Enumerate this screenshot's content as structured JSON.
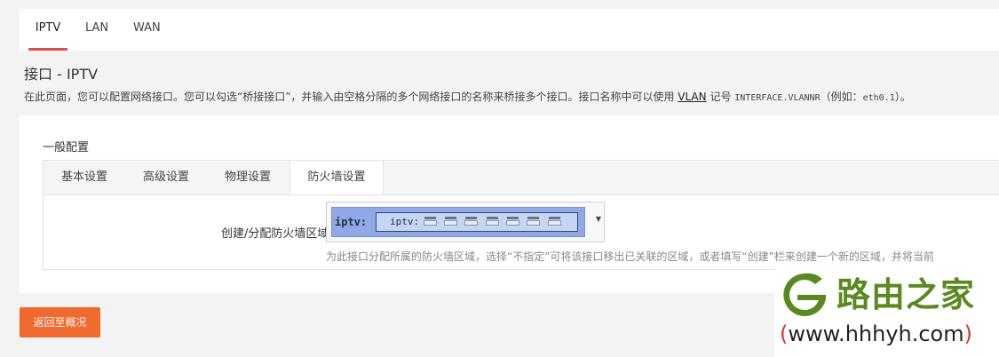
{
  "top_tabs": [
    {
      "label": "IPTV",
      "active": true
    },
    {
      "label": "LAN",
      "active": false
    },
    {
      "label": "WAN",
      "active": false
    }
  ],
  "page": {
    "title": "接口 - IPTV",
    "desc_part1": "在此页面，您可以配置网络接口。您可以勾选“桥接接口”，并输入由空格分隔的多个网络接口的名称来桥接多个接口。接口名称中可以使用 ",
    "desc_link": "VLAN",
    "desc_part2": " 记号 ",
    "desc_code": "INTERFACE.VLANNR",
    "desc_part3": "（例如：",
    "desc_example": "eth0.1",
    "desc_part4": "）。"
  },
  "general": {
    "section_title": "一般配置",
    "tabs": [
      {
        "label": "基本设置",
        "active": false
      },
      {
        "label": "高级设置",
        "active": false
      },
      {
        "label": "物理设置",
        "active": false
      },
      {
        "label": "防火墙设置",
        "active": true
      }
    ],
    "firewall_zone": {
      "label": "创建/分配防火墙区域",
      "zone_name": "iptv:",
      "network_name": "iptv:",
      "accent_color": "#90a8e6",
      "dropdown_icon": "triangle-down",
      "help": "为此接口分配所属的防火墙区域，选择“不指定”可将该接口移出已关联的区域，或者填写“创建”栏来创建一个新的区域，并将当前"
    }
  },
  "actions": {
    "back_label": "返回至概况",
    "back_color": "#f0692e"
  },
  "watermark": {
    "logo_text": "路由之家",
    "url_open": "(",
    "url": "www.hhhyh.com",
    "url_close": ")"
  }
}
